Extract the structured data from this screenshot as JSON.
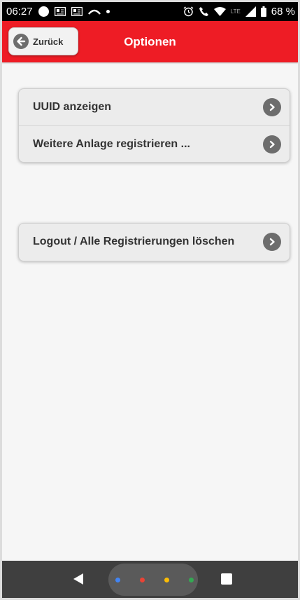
{
  "status_bar": {
    "time": "06:27",
    "network_type": "LTE",
    "battery": "68 %",
    "icons": [
      "circle-icon",
      "news-icon",
      "news-icon",
      "missed-call-icon",
      "dot-icon",
      "alarm-icon",
      "call-icon",
      "wifi-icon",
      "signal-icon",
      "battery-icon"
    ]
  },
  "header": {
    "back_label": "Zurück",
    "title": "Optionen",
    "color": "#ee1c25"
  },
  "groups": [
    {
      "items": [
        {
          "label": "UUID anzeigen"
        },
        {
          "label": "Weitere Anlage registrieren ..."
        }
      ]
    },
    {
      "items": [
        {
          "label": "Logout / Alle Registrierungen löschen"
        }
      ]
    }
  ],
  "nav_bar": {
    "dot_colors": [
      "#4285f4",
      "#ea4335",
      "#fbbc05",
      "#34a853"
    ]
  }
}
